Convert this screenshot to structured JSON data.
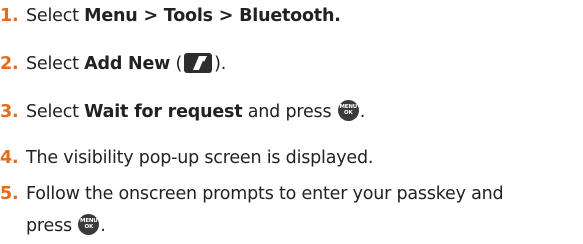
{
  "steps": [
    {
      "number": "1.",
      "text_a": "Select ",
      "bold": "Menu > Tools > Bluetooth.",
      "text_b": ""
    },
    {
      "number": "2.",
      "text_a": "Select ",
      "bold": "Add New",
      "text_b": " (",
      "icon": "right-softkey-icon",
      "text_c": ")."
    },
    {
      "number": "3.",
      "text_a": "Select ",
      "bold": "Wait for request",
      "text_b": " and press ",
      "icon": "menu-ok-key-icon",
      "text_c": "."
    },
    {
      "number": "4.",
      "text_a": "The visibility pop-up screen is displayed."
    },
    {
      "number": "5.",
      "text_a": "Follow the onscreen prompts to enter your passkey and",
      "text_line2": "press ",
      "icon": "menu-ok-key-icon",
      "text_c": "."
    }
  ],
  "menu_ok_key": {
    "top": "MENU",
    "bottom": "OK"
  },
  "colors": {
    "step_number": "#e36b1b",
    "text": "#222222",
    "key_fill": "#3a3a3a"
  }
}
